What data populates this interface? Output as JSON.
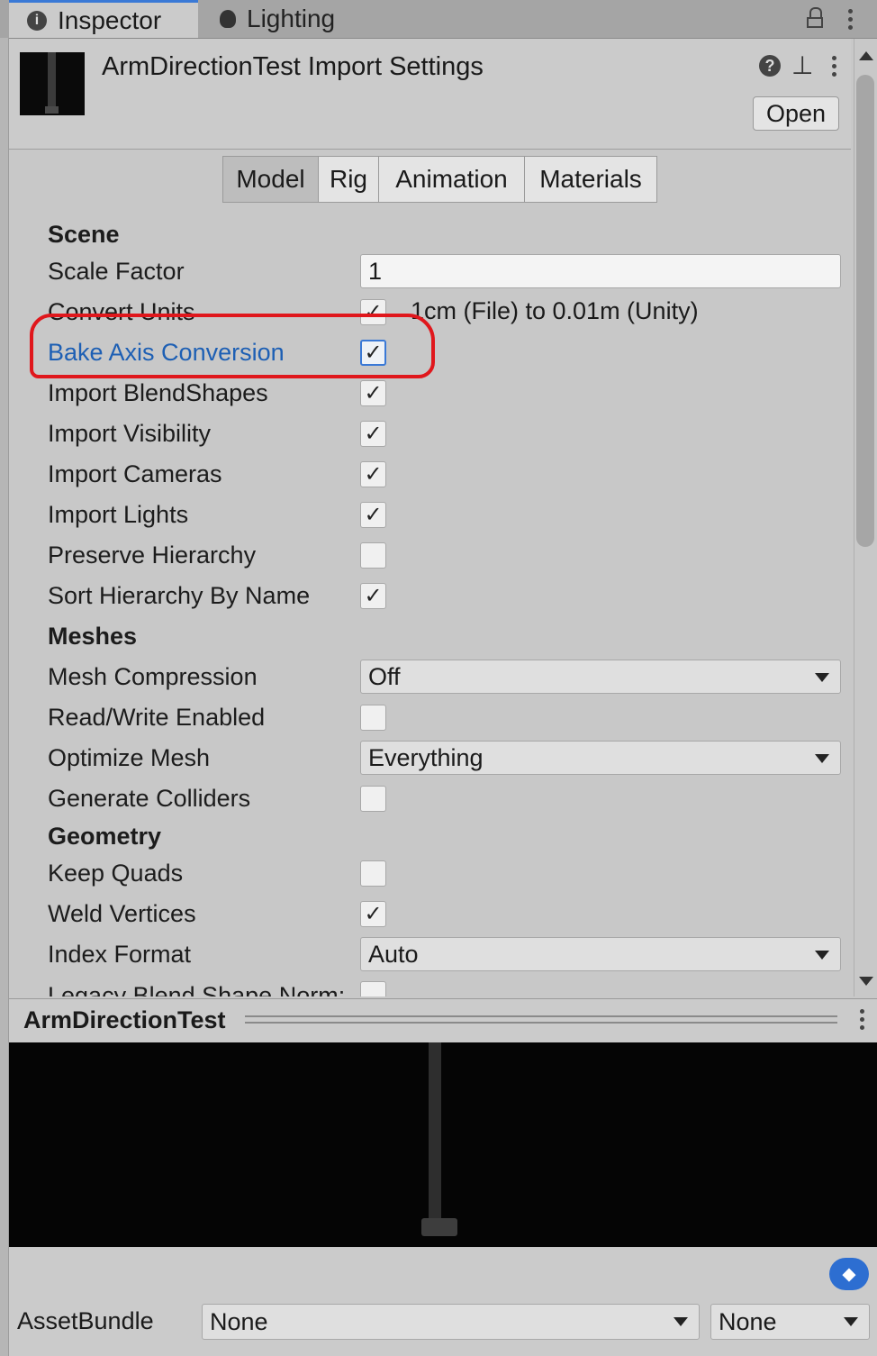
{
  "window_tabs": {
    "inspector": "Inspector",
    "lighting": "Lighting"
  },
  "header": {
    "title": "ArmDirectionTest Import Settings",
    "open_label": "Open"
  },
  "sub_tabs": [
    "Model",
    "Rig",
    "Animation",
    "Materials"
  ],
  "active_sub_tab": "Model",
  "scene": {
    "heading": "Scene",
    "scale_factor_label": "Scale Factor",
    "scale_factor_value": "1",
    "convert_units_label": "Convert Units",
    "convert_units_note": "1cm (File) to 0.01m (Unity)",
    "bake_axis_label": "Bake Axis Conversion",
    "import_blendshapes_label": "Import BlendShapes",
    "import_visibility_label": "Import Visibility",
    "import_cameras_label": "Import Cameras",
    "import_lights_label": "Import Lights",
    "preserve_hierarchy_label": "Preserve Hierarchy",
    "sort_hierarchy_label": "Sort Hierarchy By Name"
  },
  "meshes": {
    "heading": "Meshes",
    "mesh_compression_label": "Mesh Compression",
    "mesh_compression_value": "Off",
    "read_write_label": "Read/Write Enabled",
    "optimize_mesh_label": "Optimize Mesh",
    "optimize_mesh_value": "Everything",
    "generate_colliders_label": "Generate Colliders"
  },
  "geometry": {
    "heading": "Geometry",
    "keep_quads_label": "Keep Quads",
    "weld_vertices_label": "Weld Vertices",
    "index_format_label": "Index Format",
    "index_format_value": "Auto",
    "legacy_blend_label": "Legacy Blend Shape Norm:"
  },
  "checkboxes": {
    "convert_units": true,
    "bake_axis_conversion": true,
    "import_blendshapes": true,
    "import_visibility": true,
    "import_cameras": true,
    "import_lights": true,
    "preserve_hierarchy": false,
    "sort_hierarchy_by_name": true,
    "read_write_enabled": false,
    "generate_colliders": false,
    "keep_quads": false,
    "weld_vertices": true
  },
  "check_glyph": "✓",
  "preview": {
    "title": "ArmDirectionTest"
  },
  "asset_bundle": {
    "label": "AssetBundle",
    "name_value": "None",
    "variant_value": "None"
  },
  "colors": {
    "accent": "#3a79d6",
    "annotation": "#e0171c",
    "tag_icon": "#2d6ed1"
  }
}
